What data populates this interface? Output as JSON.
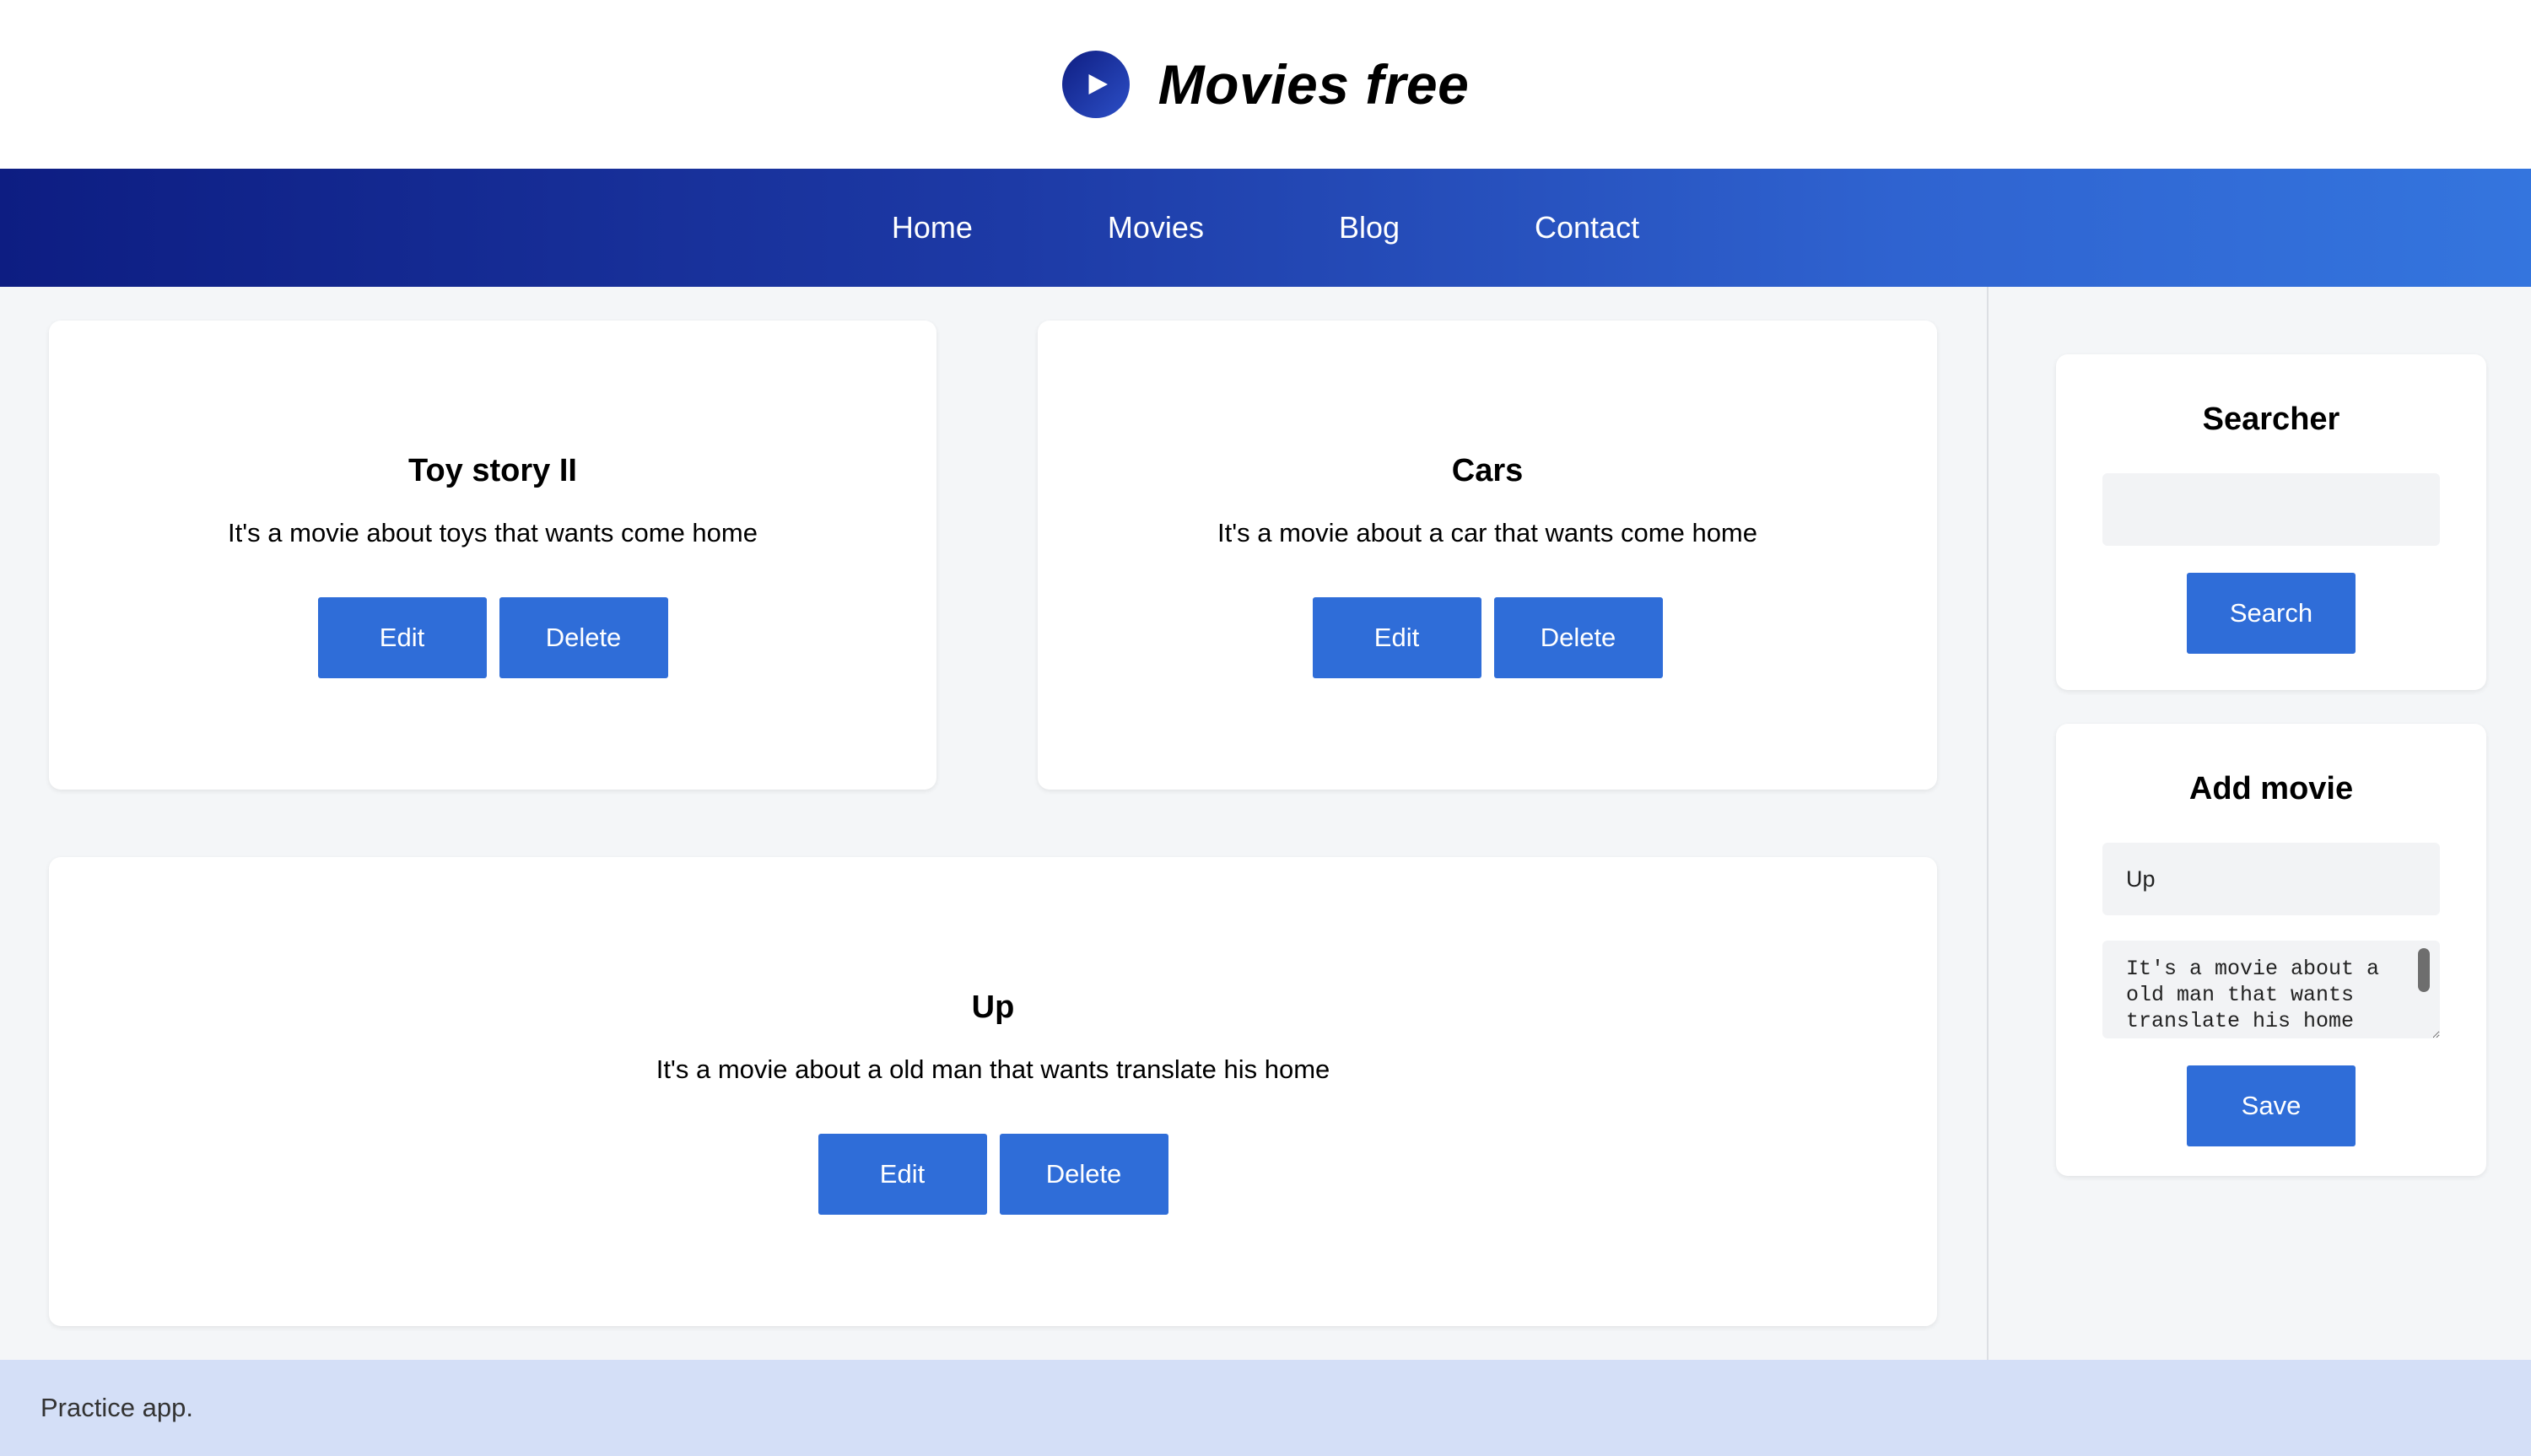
{
  "header": {
    "title": "Movies free",
    "logo_icon": "play-icon"
  },
  "nav": {
    "items": [
      {
        "label": "Home"
      },
      {
        "label": "Movies"
      },
      {
        "label": "Blog"
      },
      {
        "label": "Contact"
      }
    ]
  },
  "movies": [
    {
      "title": "Toy story II",
      "description": "It's a movie about toys that wants come home",
      "edit_label": "Edit",
      "delete_label": "Delete"
    },
    {
      "title": "Cars",
      "description": "It's a movie about a car that wants come home",
      "edit_label": "Edit",
      "delete_label": "Delete"
    },
    {
      "title": "Up",
      "description": "It's a movie about a old man that wants translate his home",
      "edit_label": "Edit",
      "delete_label": "Delete"
    }
  ],
  "sidebar": {
    "searcher": {
      "title": "Searcher",
      "input_value": "",
      "button_label": "Search"
    },
    "add_movie": {
      "title": "Add movie",
      "title_value": "Up",
      "description_value": "It's a movie about a old man that wants translate his home",
      "button_label": "Save"
    }
  },
  "footer": {
    "text": "Practice app."
  },
  "colors": {
    "accent": "#2f6dd8",
    "nav_start": "#0d1d82",
    "nav_end": "#3475de",
    "footer_bg": "#d4dff7"
  }
}
